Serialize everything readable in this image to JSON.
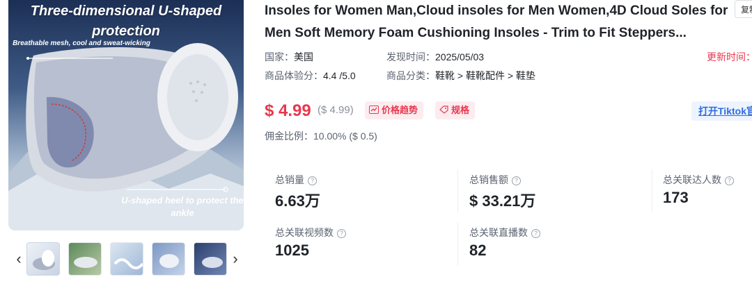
{
  "product": {
    "title": "Insoles for Women Man,Cloud insoles for Men Women,4D Cloud Soles for Men Soft Memory Foam Cushioning Insoles - Trim to Fit Steppers...",
    "copy_label": "复制",
    "image": {
      "headline": "Three-dimensional U-shaped protection",
      "caption_top": "Breathable mesh, cool and sweat-wicking",
      "caption_bottom": "U-shaped heel to protect the ankle"
    },
    "thumbnails": [
      "insole-side-view",
      "insole-green-background",
      "insole-wave-detail",
      "insole-blue-detail",
      "insole-dark-detail"
    ]
  },
  "meta": {
    "country_label": "国家：",
    "country_value": "美国",
    "found_label": "发现时间：",
    "found_value": "2025/05/03",
    "update_label": "更新时间：",
    "rating_label": "商品体验分：",
    "rating_value": "4.4 /5.0",
    "category_label": "商品分类：",
    "category_value": "鞋靴 > 鞋靴配件 > 鞋垫"
  },
  "pricing": {
    "price": "$ 4.99",
    "original": "($ 4.99)",
    "trend_label": "价格趋势",
    "spec_label": "规格",
    "tiktok_label": "打开Tiktok官",
    "commission_label": "佣金比例：",
    "commission_value": "10.00% ($ 0.5)"
  },
  "stats": {
    "total_sales_label": "总销量",
    "total_sales_value": "6.63万",
    "total_revenue_label": "总销售额",
    "total_revenue_value": "$ 33.21万",
    "influencers_label": "总关联达人数",
    "influencers_value": "173",
    "videos_label": "总关联视频数",
    "videos_value": "1025",
    "lives_label": "总关联直播数",
    "lives_value": "82"
  },
  "colors": {
    "accent_red": "#e8384f",
    "link_blue": "#2d6cdf",
    "tag_bg": "#fdecef"
  }
}
